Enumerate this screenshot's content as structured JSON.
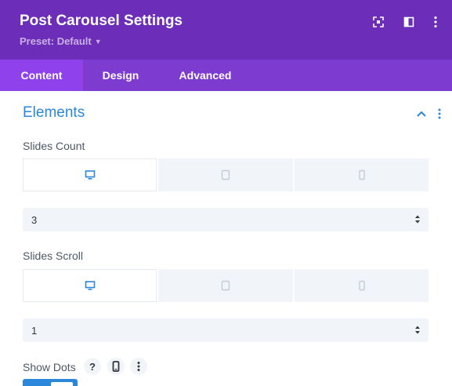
{
  "header": {
    "title": "Post Carousel Settings",
    "preset": "Preset: Default",
    "icons": [
      "expand-icon",
      "sidebar-layout-icon",
      "more-vertical-icon"
    ]
  },
  "tabs": [
    {
      "label": "Content",
      "active": true
    },
    {
      "label": "Design",
      "active": false
    },
    {
      "label": "Advanced",
      "active": false
    }
  ],
  "section": {
    "title": "Elements",
    "icons": [
      "chevron-up-icon",
      "more-vertical-icon"
    ]
  },
  "fields": {
    "slides_count": {
      "label": "Slides Count",
      "devices": [
        "desktop",
        "tablet",
        "phone"
      ],
      "active_device": "desktop",
      "value": "3"
    },
    "slides_scroll": {
      "label": "Slides Scroll",
      "devices": [
        "desktop",
        "tablet",
        "phone"
      ],
      "active_device": "desktop",
      "value": "1"
    },
    "show_dots": {
      "label": "Show Dots",
      "icons": [
        "help-icon",
        "phone-icon",
        "more-vertical-icon"
      ],
      "toggle_on": true
    }
  },
  "colors": {
    "header_bg": "#6c2eb9",
    "tabs_bg": "#7e3bd0",
    "active_tab_bg": "#8f42ec",
    "accent_blue": "#2b87da",
    "field_bg": "#f1f5f9"
  }
}
